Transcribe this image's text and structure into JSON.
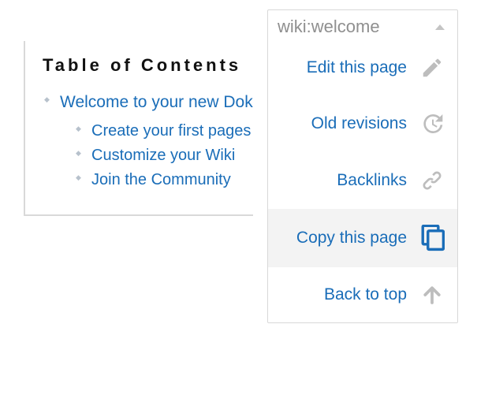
{
  "toc": {
    "title": "Table of Contents",
    "items": [
      {
        "label": "Welcome to your new DokuWiki",
        "children": [
          {
            "label": "Create your first pages"
          },
          {
            "label": "Customize your Wiki"
          },
          {
            "label": "Join the Community"
          }
        ]
      }
    ]
  },
  "panel": {
    "title": "wiki:welcome",
    "items": [
      {
        "key": "edit",
        "label": "Edit this page",
        "icon": "pencil-icon",
        "highlight": false
      },
      {
        "key": "revisions",
        "label": "Old revisions",
        "icon": "history-icon",
        "highlight": false
      },
      {
        "key": "backlinks",
        "label": "Backlinks",
        "icon": "link-icon",
        "highlight": false
      },
      {
        "key": "copy",
        "label": "Copy this page",
        "icon": "copy-icon",
        "highlight": true
      },
      {
        "key": "top",
        "label": "Back to top",
        "icon": "arrow-up-icon",
        "highlight": false
      }
    ]
  },
  "colors": {
    "link": "#1a6db8",
    "iconGrey": "#bdbdbd",
    "iconBlue": "#1a6db8"
  }
}
